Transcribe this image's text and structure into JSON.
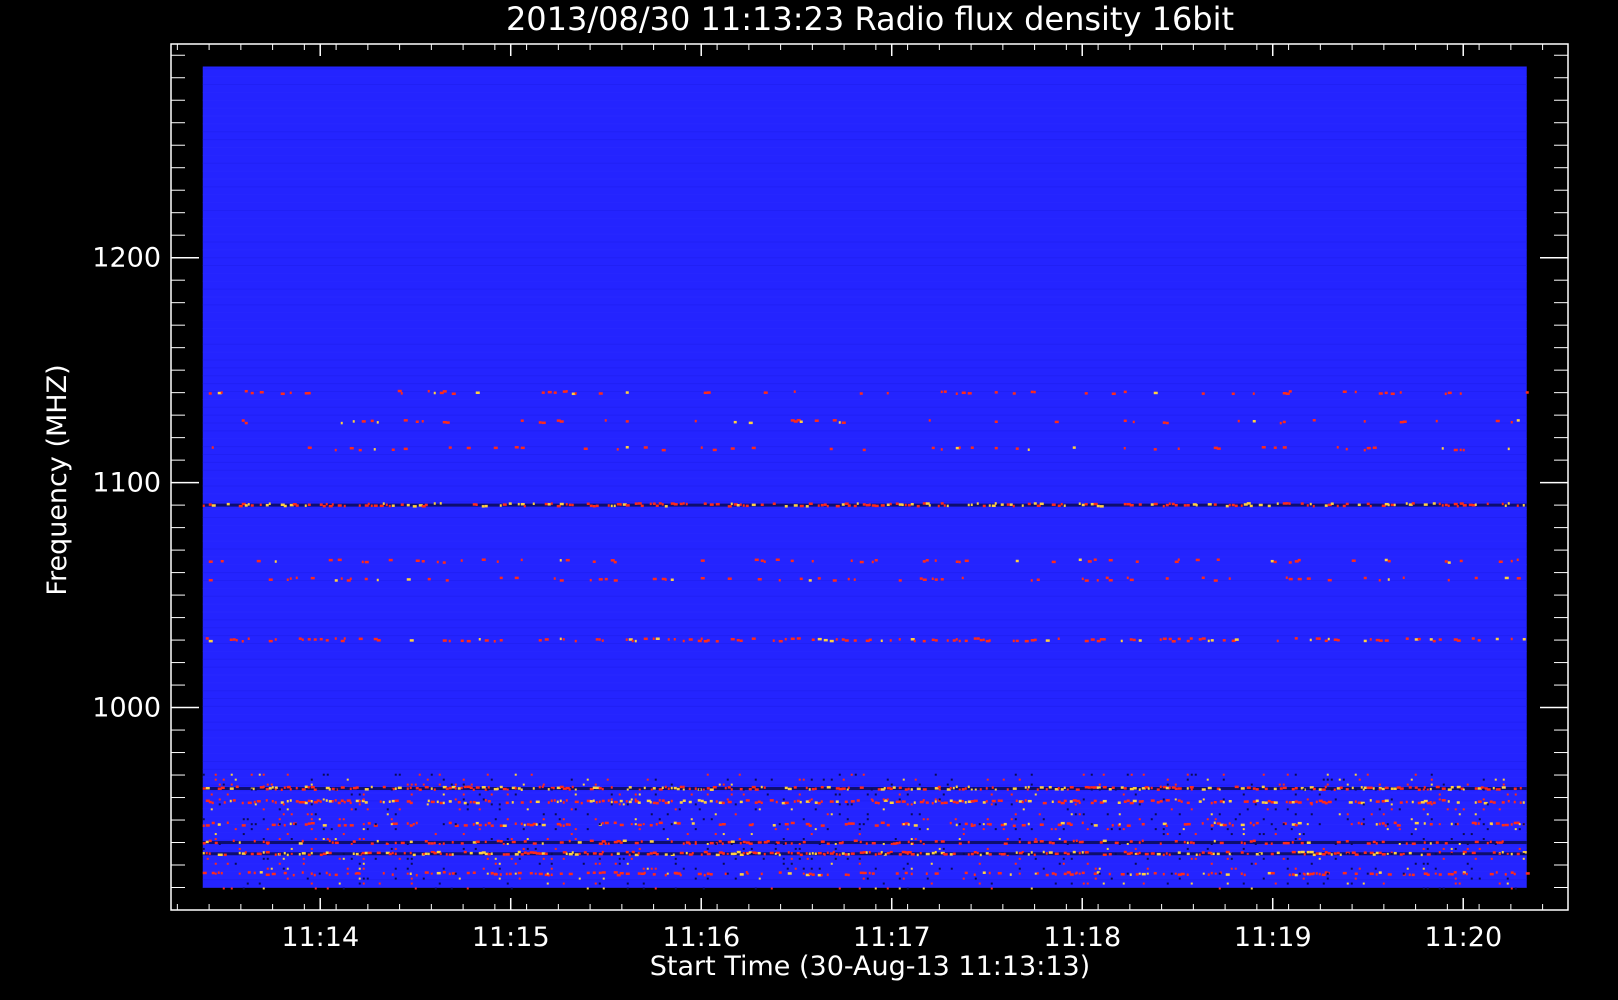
{
  "chart_data": {
    "type": "heatmap",
    "title": "2013/08/30 11:13:23 Radio flux density 16bit",
    "xlabel": "Start Time (30-Aug-13 11:13:13)",
    "ylabel": "Frequency (MHZ)",
    "x_ticks": [
      "11:14",
      "11:15",
      "11:16",
      "11:17",
      "11:18",
      "11:19",
      "11:20"
    ],
    "y_ticks": [
      1000,
      1100,
      1200
    ],
    "x_range": [
      "11:13:13",
      "11:20:33"
    ],
    "ylim": [
      910,
      1295
    ],
    "data_time_range": [
      "11:13:23",
      "11:20:20"
    ],
    "data_freq_range": [
      920,
      1285
    ],
    "colors": {
      "background": "#000000",
      "low": "#2424ff",
      "dark_band": "#0a0a55",
      "mid": "#ff2a1a",
      "high": "#ffd040",
      "axis": "#ffffff"
    },
    "bands": [
      {
        "freq": 1090,
        "intensity": "high",
        "type": "dark+bright"
      },
      {
        "freq": 1030,
        "intensity": "medium",
        "type": "dotted"
      },
      {
        "freq": 1140,
        "intensity": "low",
        "type": "sparse"
      },
      {
        "freq": 1127,
        "intensity": "low",
        "type": "sparse"
      },
      {
        "freq": 1115,
        "intensity": "low",
        "type": "sparse"
      },
      {
        "freq": 1065,
        "intensity": "low",
        "type": "sparse"
      },
      {
        "freq": 1057,
        "intensity": "low",
        "type": "sparse"
      },
      {
        "freq": 964,
        "intensity": "high",
        "type": "dark+bright"
      },
      {
        "freq": 958,
        "intensity": "high",
        "type": "bright"
      },
      {
        "freq": 948,
        "intensity": "medium",
        "type": "bright"
      },
      {
        "freq": 940,
        "intensity": "medium",
        "type": "dark+bright"
      },
      {
        "freq": 935,
        "intensity": "high",
        "type": "dark+bright"
      },
      {
        "freq": 926,
        "intensity": "medium",
        "type": "bright"
      }
    ]
  }
}
